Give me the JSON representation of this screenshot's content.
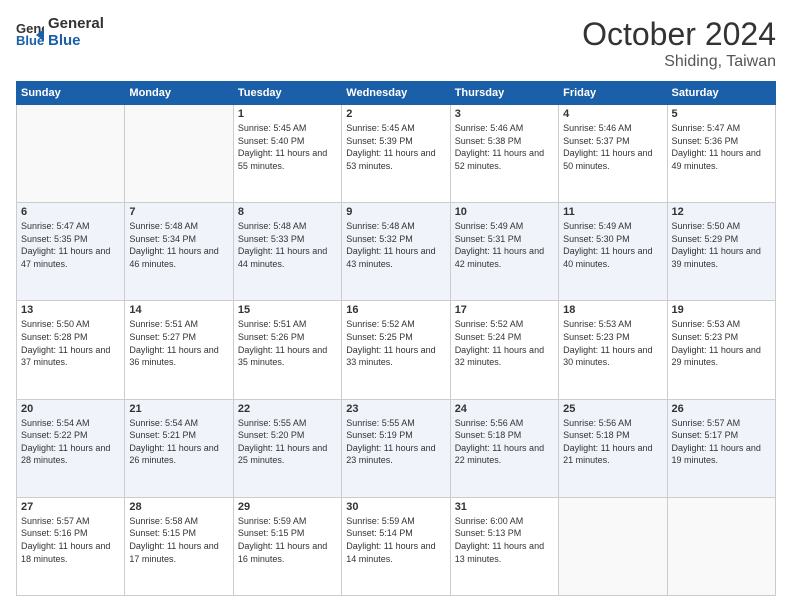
{
  "header": {
    "logo_line1": "General",
    "logo_line2": "Blue",
    "month": "October 2024",
    "location": "Shiding, Taiwan"
  },
  "days_of_week": [
    "Sunday",
    "Monday",
    "Tuesday",
    "Wednesday",
    "Thursday",
    "Friday",
    "Saturday"
  ],
  "weeks": [
    [
      {
        "day": "",
        "info": ""
      },
      {
        "day": "",
        "info": ""
      },
      {
        "day": "1",
        "info": "Sunrise: 5:45 AM\nSunset: 5:40 PM\nDaylight: 11 hours and 55 minutes."
      },
      {
        "day": "2",
        "info": "Sunrise: 5:45 AM\nSunset: 5:39 PM\nDaylight: 11 hours and 53 minutes."
      },
      {
        "day": "3",
        "info": "Sunrise: 5:46 AM\nSunset: 5:38 PM\nDaylight: 11 hours and 52 minutes."
      },
      {
        "day": "4",
        "info": "Sunrise: 5:46 AM\nSunset: 5:37 PM\nDaylight: 11 hours and 50 minutes."
      },
      {
        "day": "5",
        "info": "Sunrise: 5:47 AM\nSunset: 5:36 PM\nDaylight: 11 hours and 49 minutes."
      }
    ],
    [
      {
        "day": "6",
        "info": "Sunrise: 5:47 AM\nSunset: 5:35 PM\nDaylight: 11 hours and 47 minutes."
      },
      {
        "day": "7",
        "info": "Sunrise: 5:48 AM\nSunset: 5:34 PM\nDaylight: 11 hours and 46 minutes."
      },
      {
        "day": "8",
        "info": "Sunrise: 5:48 AM\nSunset: 5:33 PM\nDaylight: 11 hours and 44 minutes."
      },
      {
        "day": "9",
        "info": "Sunrise: 5:48 AM\nSunset: 5:32 PM\nDaylight: 11 hours and 43 minutes."
      },
      {
        "day": "10",
        "info": "Sunrise: 5:49 AM\nSunset: 5:31 PM\nDaylight: 11 hours and 42 minutes."
      },
      {
        "day": "11",
        "info": "Sunrise: 5:49 AM\nSunset: 5:30 PM\nDaylight: 11 hours and 40 minutes."
      },
      {
        "day": "12",
        "info": "Sunrise: 5:50 AM\nSunset: 5:29 PM\nDaylight: 11 hours and 39 minutes."
      }
    ],
    [
      {
        "day": "13",
        "info": "Sunrise: 5:50 AM\nSunset: 5:28 PM\nDaylight: 11 hours and 37 minutes."
      },
      {
        "day": "14",
        "info": "Sunrise: 5:51 AM\nSunset: 5:27 PM\nDaylight: 11 hours and 36 minutes."
      },
      {
        "day": "15",
        "info": "Sunrise: 5:51 AM\nSunset: 5:26 PM\nDaylight: 11 hours and 35 minutes."
      },
      {
        "day": "16",
        "info": "Sunrise: 5:52 AM\nSunset: 5:25 PM\nDaylight: 11 hours and 33 minutes."
      },
      {
        "day": "17",
        "info": "Sunrise: 5:52 AM\nSunset: 5:24 PM\nDaylight: 11 hours and 32 minutes."
      },
      {
        "day": "18",
        "info": "Sunrise: 5:53 AM\nSunset: 5:23 PM\nDaylight: 11 hours and 30 minutes."
      },
      {
        "day": "19",
        "info": "Sunrise: 5:53 AM\nSunset: 5:23 PM\nDaylight: 11 hours and 29 minutes."
      }
    ],
    [
      {
        "day": "20",
        "info": "Sunrise: 5:54 AM\nSunset: 5:22 PM\nDaylight: 11 hours and 28 minutes."
      },
      {
        "day": "21",
        "info": "Sunrise: 5:54 AM\nSunset: 5:21 PM\nDaylight: 11 hours and 26 minutes."
      },
      {
        "day": "22",
        "info": "Sunrise: 5:55 AM\nSunset: 5:20 PM\nDaylight: 11 hours and 25 minutes."
      },
      {
        "day": "23",
        "info": "Sunrise: 5:55 AM\nSunset: 5:19 PM\nDaylight: 11 hours and 23 minutes."
      },
      {
        "day": "24",
        "info": "Sunrise: 5:56 AM\nSunset: 5:18 PM\nDaylight: 11 hours and 22 minutes."
      },
      {
        "day": "25",
        "info": "Sunrise: 5:56 AM\nSunset: 5:18 PM\nDaylight: 11 hours and 21 minutes."
      },
      {
        "day": "26",
        "info": "Sunrise: 5:57 AM\nSunset: 5:17 PM\nDaylight: 11 hours and 19 minutes."
      }
    ],
    [
      {
        "day": "27",
        "info": "Sunrise: 5:57 AM\nSunset: 5:16 PM\nDaylight: 11 hours and 18 minutes."
      },
      {
        "day": "28",
        "info": "Sunrise: 5:58 AM\nSunset: 5:15 PM\nDaylight: 11 hours and 17 minutes."
      },
      {
        "day": "29",
        "info": "Sunrise: 5:59 AM\nSunset: 5:15 PM\nDaylight: 11 hours and 16 minutes."
      },
      {
        "day": "30",
        "info": "Sunrise: 5:59 AM\nSunset: 5:14 PM\nDaylight: 11 hours and 14 minutes."
      },
      {
        "day": "31",
        "info": "Sunrise: 6:00 AM\nSunset: 5:13 PM\nDaylight: 11 hours and 13 minutes."
      },
      {
        "day": "",
        "info": ""
      },
      {
        "day": "",
        "info": ""
      }
    ]
  ]
}
